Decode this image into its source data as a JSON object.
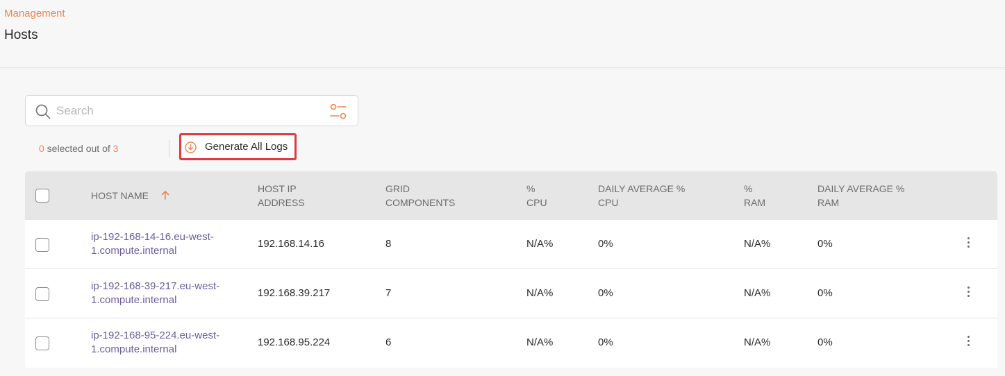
{
  "header": {
    "breadcrumb": "Management",
    "title": "Hosts"
  },
  "search": {
    "placeholder": "Search",
    "value": ""
  },
  "selection": {
    "selected": "0",
    "middle": " selected out of ",
    "total": "3"
  },
  "actions": {
    "generate_logs_label": "Generate All Logs"
  },
  "table": {
    "columns": {
      "host_name": "HOST NAME",
      "host_ip_1": "HOST IP",
      "host_ip_2": "ADDRESS",
      "grid_1": "GRID",
      "grid_2": "COMPONENTS",
      "cpu_1": "%",
      "cpu_2": "CPU",
      "daily_cpu_1": "DAILY AVERAGE %",
      "daily_cpu_2": "CPU",
      "ram_1": "%",
      "ram_2": "RAM",
      "daily_ram_1": "DAILY AVERAGE %",
      "daily_ram_2": "RAM"
    },
    "sort": {
      "column": "host_name",
      "direction": "ascending"
    },
    "rows": [
      {
        "host_name_1": "ip-192-168-14-16.eu-west-",
        "host_name_2": "1.compute.internal",
        "ip": "192.168.14.16",
        "grid_components": "8",
        "cpu": "N/A%",
        "daily_cpu": "0%",
        "ram": "N/A%",
        "daily_ram": "0%"
      },
      {
        "host_name_1": "ip-192-168-39-217.eu-west-",
        "host_name_2": "1.compute.internal",
        "ip": "192.168.39.217",
        "grid_components": "7",
        "cpu": "N/A%",
        "daily_cpu": "0%",
        "ram": "N/A%",
        "daily_ram": "0%"
      },
      {
        "host_name_1": "ip-192-168-95-224.eu-west-",
        "host_name_2": "1.compute.internal",
        "ip": "192.168.95.224",
        "grid_components": "6",
        "cpu": "N/A%",
        "daily_cpu": "0%",
        "ram": "N/A%",
        "daily_ram": "0%"
      }
    ]
  },
  "colors": {
    "accent": "#f0844c",
    "link": "#6d5c9f",
    "highlight_border": "#e03a3a",
    "header_bg": "#e6e6e6"
  },
  "icons": {
    "search": "search-icon",
    "filter": "filter-settings-icon",
    "download": "download-circle-icon",
    "sort": "arrow-up-icon",
    "row_menu": "kebab-menu-icon"
  }
}
